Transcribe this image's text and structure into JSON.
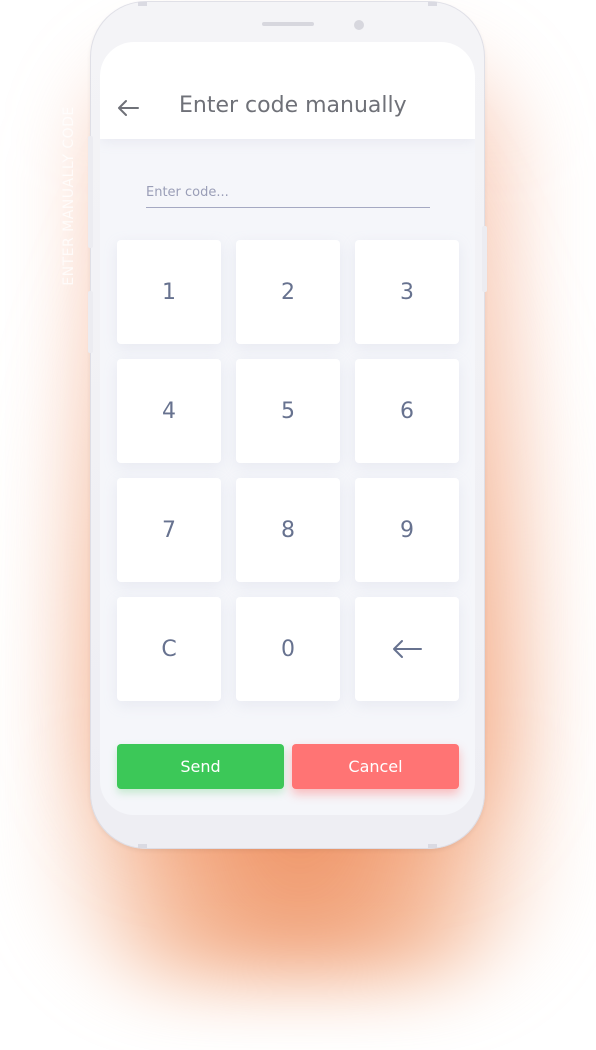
{
  "side_label": "ENTER MANUALLY CODE",
  "header": {
    "title": "Enter code manually",
    "back_icon": "arrow-left-icon"
  },
  "code_input": {
    "value": "",
    "placeholder": "Enter code..."
  },
  "keypad": {
    "keys": [
      "1",
      "2",
      "3",
      "4",
      "5",
      "6",
      "7",
      "8",
      "9",
      "C",
      "0"
    ],
    "backspace_icon": "arrow-left-icon"
  },
  "actions": {
    "send_label": "Send",
    "cancel_label": "Cancel"
  },
  "colors": {
    "send": "#3cc858",
    "cancel": "#ff7474",
    "key_text": "#67728f",
    "glow": "#ec8552"
  }
}
